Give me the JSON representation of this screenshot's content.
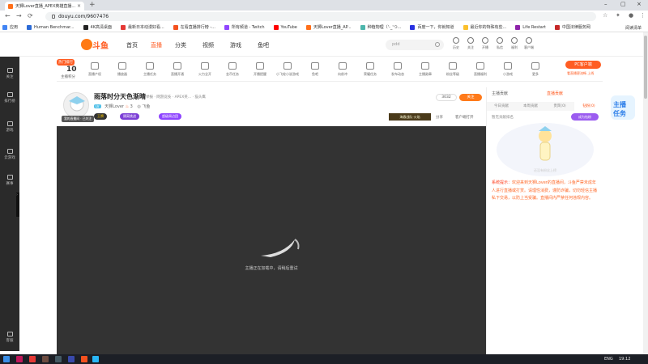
{
  "browser": {
    "tab_title": "天狮Lover直播_APEX英雄直播...",
    "url": "douyu.com/9607476",
    "bookmarks": [
      {
        "label": "应用",
        "color": "#4285f4"
      },
      {
        "label": "Human Benchmar...",
        "color": "#2c6bd6"
      },
      {
        "label": "4K高清桌面",
        "color": "#222222"
      },
      {
        "label": "最新日本动漫好看...",
        "color": "#e53935"
      },
      {
        "label": "在看直播排行榜 -...",
        "color": "#f4511e"
      },
      {
        "label": "所有频道 - Twitch",
        "color": "#9146ff"
      },
      {
        "label": "YouTube",
        "color": "#ff0000"
      },
      {
        "label": "天狮Lover直播_AP...",
        "color": "#ff6f1a"
      },
      {
        "label": "种植物理（'-_'つ...",
        "color": "#4db6ac"
      },
      {
        "label": "百度一下，你就知道",
        "color": "#2932e1"
      },
      {
        "label": "最近你的特殊有些...",
        "color": "#fbc02d"
      },
      {
        "label": "Life Restart",
        "color": "#8e24aa"
      },
      {
        "label": "中国法律服务网",
        "color": "#c62828"
      }
    ],
    "reading_list": "阅读清单"
  },
  "site": {
    "logo_text": "斗鱼",
    "nav": [
      "首页",
      "直播",
      "分类",
      "视频",
      "游戏",
      "鱼吧"
    ],
    "search_placeholder": "pdd",
    "header_icons": [
      "历史",
      "关注",
      "开播",
      "私信",
      "福利",
      "客户端"
    ]
  },
  "leftbar": [
    "关注",
    "排行榜",
    "游戏",
    "云游戏",
    "赛事",
    "客服"
  ],
  "toolbar": {
    "rank_badge": "热门排行",
    "rank_num": "10",
    "rank_label": "主播积分",
    "items": [
      "直播产权",
      "播放器",
      "主播任务",
      "直播开通",
      "火力全开",
      "金币任务",
      "开播提醒",
      "小飞轮小说游戏",
      "鱼吧",
      "向前冲",
      "荣耀任务",
      "发布动态",
      "主播勋章",
      "粉丝等级",
      "直播福利",
      "小游戏",
      "更多"
    ],
    "pc_button": "PC客户端",
    "pc_sub": "看直播更流畅 上线"
  },
  "stream": {
    "title": "雨落时分天色渐晴",
    "meta": "举报  · 网游竞技 · APEX英... · 猫头鹰",
    "level": "LV",
    "streamer": "天狮Lover",
    "fans": "3",
    "fish": "飞鱼",
    "avatar_tag": "我的直播间 · 已关注",
    "chip1": "王牌",
    "chip2": "隔离挑战",
    "chip3": "超级周边团",
    "heat": "3032",
    "follow": "关注",
    "banner": "海春战队·火焰",
    "share": "分享",
    "client": "客户端打开",
    "loading": "主播正在加载中，请稍后重试"
  },
  "rightpanel": {
    "head": "主播贡献",
    "head2": "直播贡献",
    "tabs": [
      "今日贡献",
      "本周贡献",
      "贵宾(0)",
      "钻粉(0)"
    ],
    "sub": "暂无贡献排名",
    "button": "成为钻粉",
    "illus_caption": "还没有粉丝上榜",
    "notice_key": "系统提示：",
    "notice": "欢迎来到天狮Lover的直播间，斗鱼严禁未成年人进行直播或打赏。请理性消费，谨防诈骗，切勿轻信主播私下交易，以防上当受骗。直播间内严禁任何违规内容。"
  },
  "taskbar": {
    "lang": "ENG",
    "time": "19:12"
  }
}
